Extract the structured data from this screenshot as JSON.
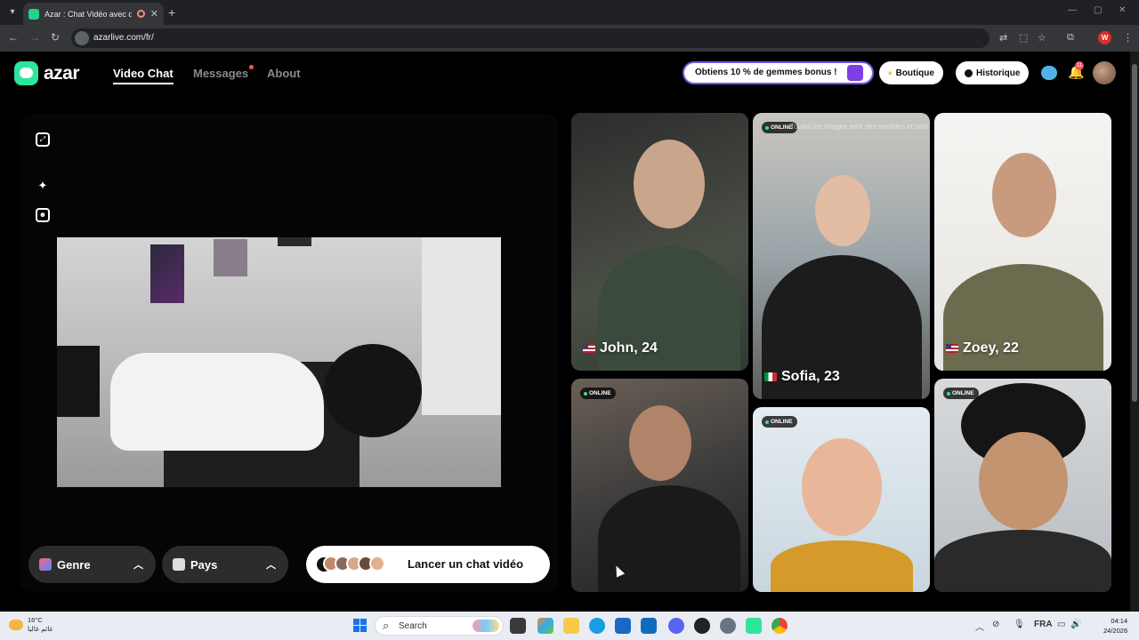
{
  "browser": {
    "tab_title": "Azar : Chat Vidéo avec de n",
    "url": "azarlive.com/fr/"
  },
  "site": {
    "logo_text": "azar",
    "nav": [
      "Video Chat",
      "Messages",
      "About"
    ],
    "promo_text": "Obtiens 10 % de gemmes bonus !",
    "shop_label": "Boutique",
    "history_label": "Historique",
    "notification_count": "11"
  },
  "filters": {
    "gender_label": "Genre",
    "country_label": "Pays",
    "launch_label": "Lancer un chat vidéo"
  },
  "cards": [
    {
      "name": "John, 24",
      "flag": "us"
    },
    {
      "name": "Sofia, 23",
      "flag": "it",
      "status": "ONLINE"
    },
    {
      "name": "Zoey, 22",
      "flag": "us"
    },
    {
      "status": "ONLINE"
    },
    {
      "status": "ONLINE"
    },
    {
      "status": "ONLINE"
    }
  ],
  "card_caption": "Toutes les images sont des modèles et sont l",
  "taskbar": {
    "temperature": "16°C",
    "weather_text": "غائم غالبا",
    "search_placeholder": "Search",
    "language": "FRA",
    "time": "04:14",
    "date": "24/2026"
  },
  "colors": {
    "brand_green": "#2ee59d",
    "promo_border": "#6c5ce7",
    "page_bg": "#000000"
  }
}
